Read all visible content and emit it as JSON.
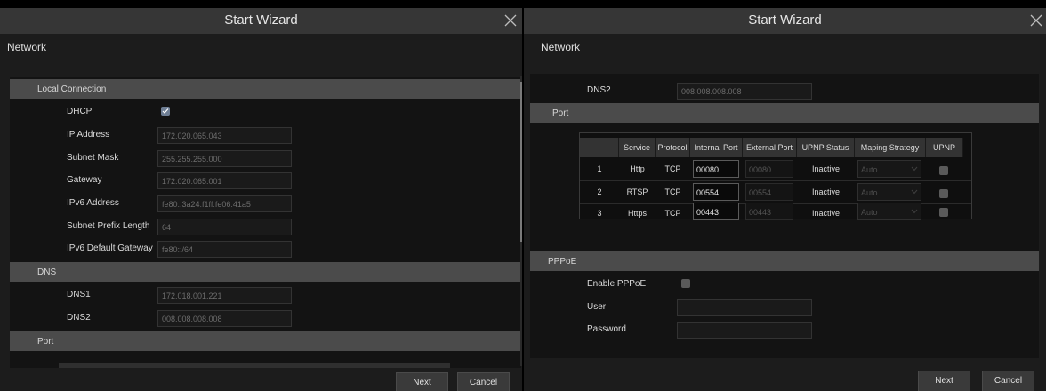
{
  "left": {
    "title": "Start Wizard",
    "section": "Network",
    "local_connection": "Local Connection",
    "dhcp_label": "DHCP",
    "ip_label": "IP Address",
    "ip_value": "172.020.065.043",
    "subnet_label": "Subnet Mask",
    "subnet_value": "255.255.255.000",
    "gateway_label": "Gateway",
    "gateway_value": "172.020.065.001",
    "ipv6_label": "IPv6 Address",
    "ipv6_value": "fe80::3a24:f1ff:fe06:41a5",
    "prefix_label": "Subnet Prefix Length",
    "prefix_value": "64",
    "ipv6gw_label": "IPv6 Default Gateway",
    "ipv6gw_value": "fe80::/64",
    "dns_group": "DNS",
    "dns1_label": "DNS1",
    "dns1_value": "172.018.001.221",
    "dns2_label": "DNS2",
    "dns2_value": "008.008.008.008",
    "port_group": "Port",
    "next": "Next",
    "cancel": "Cancel"
  },
  "right": {
    "title": "Start Wizard",
    "section": "Network",
    "dns2_label": "DNS2",
    "dns2_value": "008.008.008.008",
    "port_group": "Port",
    "table": {
      "headers": [
        "Service",
        "Protocol",
        "Internal Port",
        "External Port",
        "UPNP Status",
        "Maping Strategy",
        "UPNP"
      ],
      "rows": [
        {
          "no": "1",
          "service": "Http",
          "protocol": "TCP",
          "internal": "00080",
          "external": "00080",
          "status": "Inactive",
          "strategy": "Auto"
        },
        {
          "no": "2",
          "service": "RTSP",
          "protocol": "TCP",
          "internal": "00554",
          "external": "00554",
          "status": "Inactive",
          "strategy": "Auto"
        },
        {
          "no": "3",
          "service": "Https",
          "protocol": "TCP",
          "internal": "00443",
          "external": "00443",
          "status": "Inactive",
          "strategy": "Auto"
        }
      ]
    },
    "pppoe_group": "PPPoE",
    "enable_pppoe_label": "Enable PPPoE",
    "user_label": "User",
    "password_label": "Password",
    "next": "Next",
    "cancel": "Cancel"
  },
  "colors": {
    "accent_checkbox": "#6f7f95",
    "group_bar": "#4b4b4b"
  }
}
